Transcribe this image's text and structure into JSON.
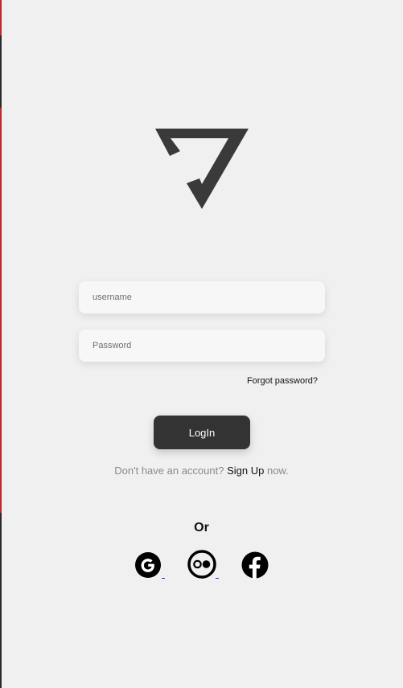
{
  "form": {
    "username_placeholder": "username",
    "password_placeholder": "Password",
    "forgot_label": "Forgot password?",
    "login_label": "LogIn"
  },
  "signup": {
    "prefix": "Don't have an account?",
    "link_label": "Sign Up",
    "suffix": "now."
  },
  "divider": {
    "or_label": "Or"
  },
  "social": [
    {
      "name": "google",
      "icon": "google-icon"
    },
    {
      "name": "flickr",
      "icon": "flickr-icon"
    },
    {
      "name": "facebook",
      "icon": "facebook-icon"
    }
  ],
  "colors": {
    "background": "#f0f0f0",
    "button": "#333333",
    "accent_edge": "#c8222a"
  }
}
